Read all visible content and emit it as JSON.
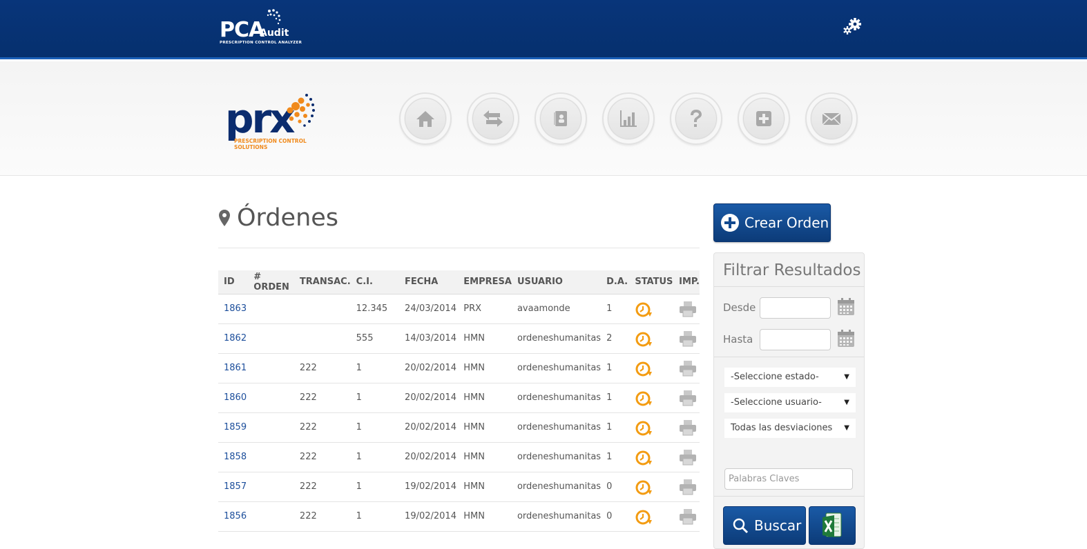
{
  "header": {
    "brand_main": "PCA",
    "brand_suffix": "Audit",
    "brand_tagline": "PRESCRIPTION CONTROL ANALYZER",
    "settings_icon": "gears-icon"
  },
  "company_logo": {
    "name": "prx",
    "tagline_1": "PRESCRIPTION CONTROL",
    "tagline_2": "SOLUTIONS"
  },
  "nav": [
    {
      "icon": "home-icon"
    },
    {
      "icon": "transfer-arrows-icon"
    },
    {
      "icon": "contacts-book-icon"
    },
    {
      "icon": "bar-chart-icon"
    },
    {
      "icon": "question-icon"
    },
    {
      "icon": "medical-cross-icon"
    },
    {
      "icon": "envelope-icon"
    }
  ],
  "page": {
    "title": "Órdenes",
    "title_icon": "map-marker-icon"
  },
  "table": {
    "columns": [
      "ID",
      "# ORDEN",
      "TRANSAC.",
      "C.I.",
      "FECHA",
      "EMPRESA",
      "USUARIO",
      "D.A.",
      "STATUS",
      "IMP."
    ],
    "rows": [
      {
        "id": "1863",
        "orden": "",
        "transac": "",
        "ci": "12.345",
        "fecha": "24/03/2014",
        "empresa": "PRX",
        "usuario": "avaamonde",
        "da": "1"
      },
      {
        "id": "1862",
        "orden": "",
        "transac": "",
        "ci": "555",
        "fecha": "14/03/2014",
        "empresa": "HMN",
        "usuario": "ordeneshumanitas",
        "da": "2"
      },
      {
        "id": "1861",
        "orden": "",
        "transac": "222",
        "ci": "1",
        "fecha": "20/02/2014",
        "empresa": "HMN",
        "usuario": "ordeneshumanitas",
        "da": "1"
      },
      {
        "id": "1860",
        "orden": "",
        "transac": "222",
        "ci": "1",
        "fecha": "20/02/2014",
        "empresa": "HMN",
        "usuario": "ordeneshumanitas",
        "da": "1"
      },
      {
        "id": "1859",
        "orden": "",
        "transac": "222",
        "ci": "1",
        "fecha": "20/02/2014",
        "empresa": "HMN",
        "usuario": "ordeneshumanitas",
        "da": "1"
      },
      {
        "id": "1858",
        "orden": "",
        "transac": "222",
        "ci": "1",
        "fecha": "20/02/2014",
        "empresa": "HMN",
        "usuario": "ordeneshumanitas",
        "da": "1"
      },
      {
        "id": "1857",
        "orden": "",
        "transac": "222",
        "ci": "1",
        "fecha": "19/02/2014",
        "empresa": "HMN",
        "usuario": "ordeneshumanitas",
        "da": "0"
      },
      {
        "id": "1856",
        "orden": "",
        "transac": "222",
        "ci": "1",
        "fecha": "19/02/2014",
        "empresa": "HMN",
        "usuario": "ordeneshumanitas",
        "da": "0"
      }
    ],
    "status_icon": "clock-refresh-icon",
    "print_icon": "printer-icon"
  },
  "actions": {
    "crear_orden": "Crear Orden"
  },
  "filter": {
    "title": "Filtrar Resultados",
    "desde_label": "Desde",
    "hasta_label": "Hasta",
    "desde_value": "",
    "hasta_value": "",
    "estado_selected": "-Seleccione estado-",
    "usuario_selected": "-Seleccione usuario-",
    "desviaciones_selected": "Todas las desviaciones",
    "keywords_placeholder": "Palabras Claves",
    "buscar_label": "Buscar",
    "excel_icon": "excel-export-icon"
  },
  "colors": {
    "header_bg": "#06306e",
    "accent_blue": "#0c3b78",
    "link_blue": "#1c4e9b",
    "status_orange": "#f39c12"
  }
}
